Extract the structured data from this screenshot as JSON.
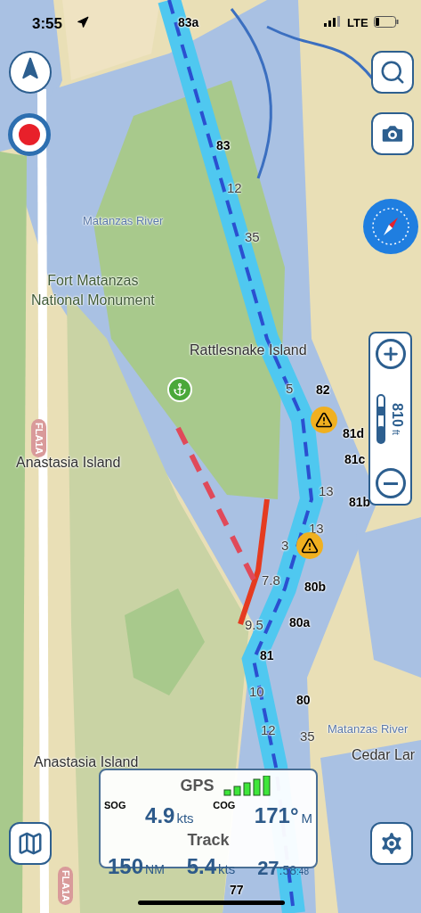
{
  "status_bar": {
    "time": "3:55",
    "network": "LTE"
  },
  "map": {
    "labels": [
      {
        "kind": "marker",
        "text": "83a"
      },
      {
        "kind": "marker",
        "text": "83"
      },
      {
        "kind": "depth",
        "text": "12"
      },
      {
        "kind": "place",
        "text": "Matanzas River"
      },
      {
        "kind": "depth",
        "text": "35"
      },
      {
        "kind": "park",
        "text": "Fort Matanzas\nNational Monument"
      },
      {
        "kind": "island",
        "text": "Rattlesnake Island"
      },
      {
        "kind": "depth",
        "text": "5"
      },
      {
        "kind": "marker",
        "text": "82"
      },
      {
        "kind": "road",
        "text": "FLA1A"
      },
      {
        "kind": "marker",
        "text": "81d"
      },
      {
        "kind": "marker",
        "text": "81c"
      },
      {
        "kind": "island",
        "text": "Anastasia Island"
      },
      {
        "kind": "depth",
        "text": "13"
      },
      {
        "kind": "marker",
        "text": "81b"
      },
      {
        "kind": "depth",
        "text": "13"
      },
      {
        "kind": "depth",
        "text": "3"
      },
      {
        "kind": "depth",
        "text": "7.8"
      },
      {
        "kind": "marker",
        "text": "80b"
      },
      {
        "kind": "marker",
        "text": "80a"
      },
      {
        "kind": "depth",
        "text": "9.5"
      },
      {
        "kind": "marker",
        "text": "81"
      },
      {
        "kind": "depth",
        "text": "10"
      },
      {
        "kind": "marker",
        "text": "80"
      },
      {
        "kind": "depth",
        "text": "12"
      },
      {
        "kind": "depth",
        "text": "35"
      },
      {
        "kind": "place",
        "text": "Matanzas River"
      },
      {
        "kind": "island",
        "text": "Cedar Lar"
      },
      {
        "kind": "island",
        "text": "Anastasia Island"
      },
      {
        "kind": "road",
        "text": "FLA1A"
      },
      {
        "kind": "marker",
        "text": "77"
      }
    ]
  },
  "zoom_control": {
    "scale": "810",
    "unit": "ft"
  },
  "gps_panel": {
    "title": "GPS",
    "sog_label": "SOG",
    "sog": "4.9",
    "sog_unit": "kts",
    "cog_label": "COG",
    "cog": "171°",
    "cog_ref": "M",
    "track_title": "Track",
    "distance": "150",
    "distance_unit": "NM",
    "avg_speed": "5.4",
    "avg_speed_unit": "kts",
    "time_hours": "27",
    "time_minutes": ":58",
    "time_seconds": ":48"
  }
}
